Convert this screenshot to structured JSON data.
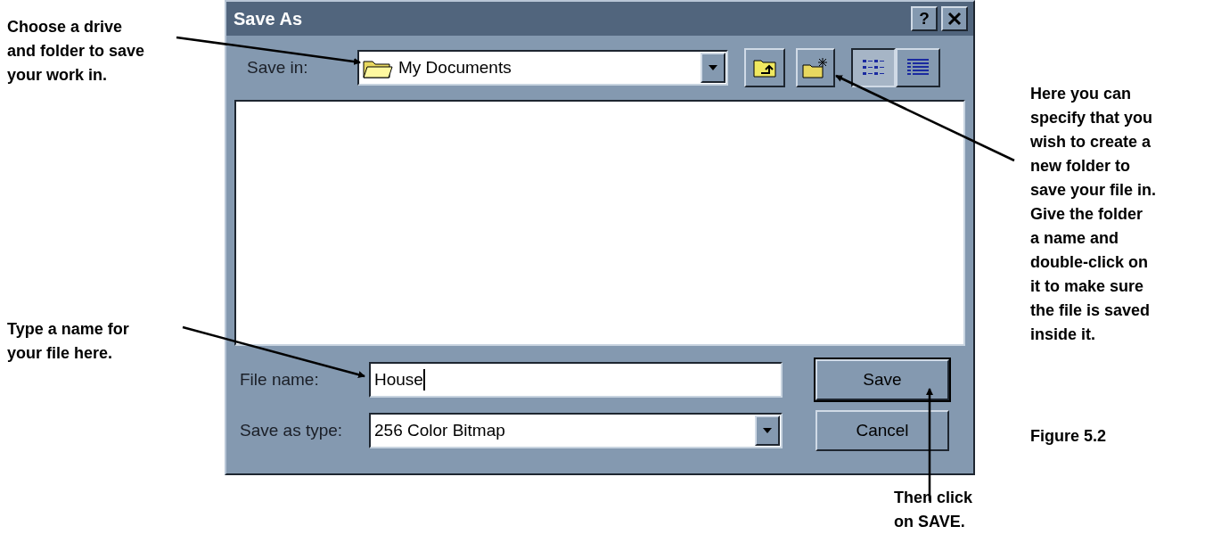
{
  "dialog": {
    "title": "Save As",
    "help_button": "?",
    "save_in": {
      "label": "Save in:",
      "value": "My Documents"
    },
    "view_buttons": [
      {
        "kind": "list",
        "selected": true
      },
      {
        "kind": "details",
        "selected": false
      }
    ],
    "file_name": {
      "label": "File name:",
      "value": "House"
    },
    "save_as_type": {
      "label": "Save as type:",
      "value": "256 Color Bitmap"
    },
    "buttons": [
      {
        "label": "Save",
        "default": true
      },
      {
        "label": "Cancel",
        "default": false
      }
    ]
  },
  "annotations": [
    {
      "lines": [
        "Choose a drive",
        "and folder to save",
        "your work in."
      ]
    },
    {
      "lines": [
        "Type a name for",
        "your file here."
      ]
    },
    {
      "lines": [
        "Here you can",
        "specify that you",
        "wish to create a",
        "new folder to",
        "save your file in.",
        "Give the folder",
        "a name and",
        "double-click on",
        "it to make sure",
        "the file is saved",
        "inside it."
      ]
    },
    {
      "lines": [
        "Then click",
        "on SAVE."
      ]
    }
  ],
  "caption": "Figure 5.2"
}
